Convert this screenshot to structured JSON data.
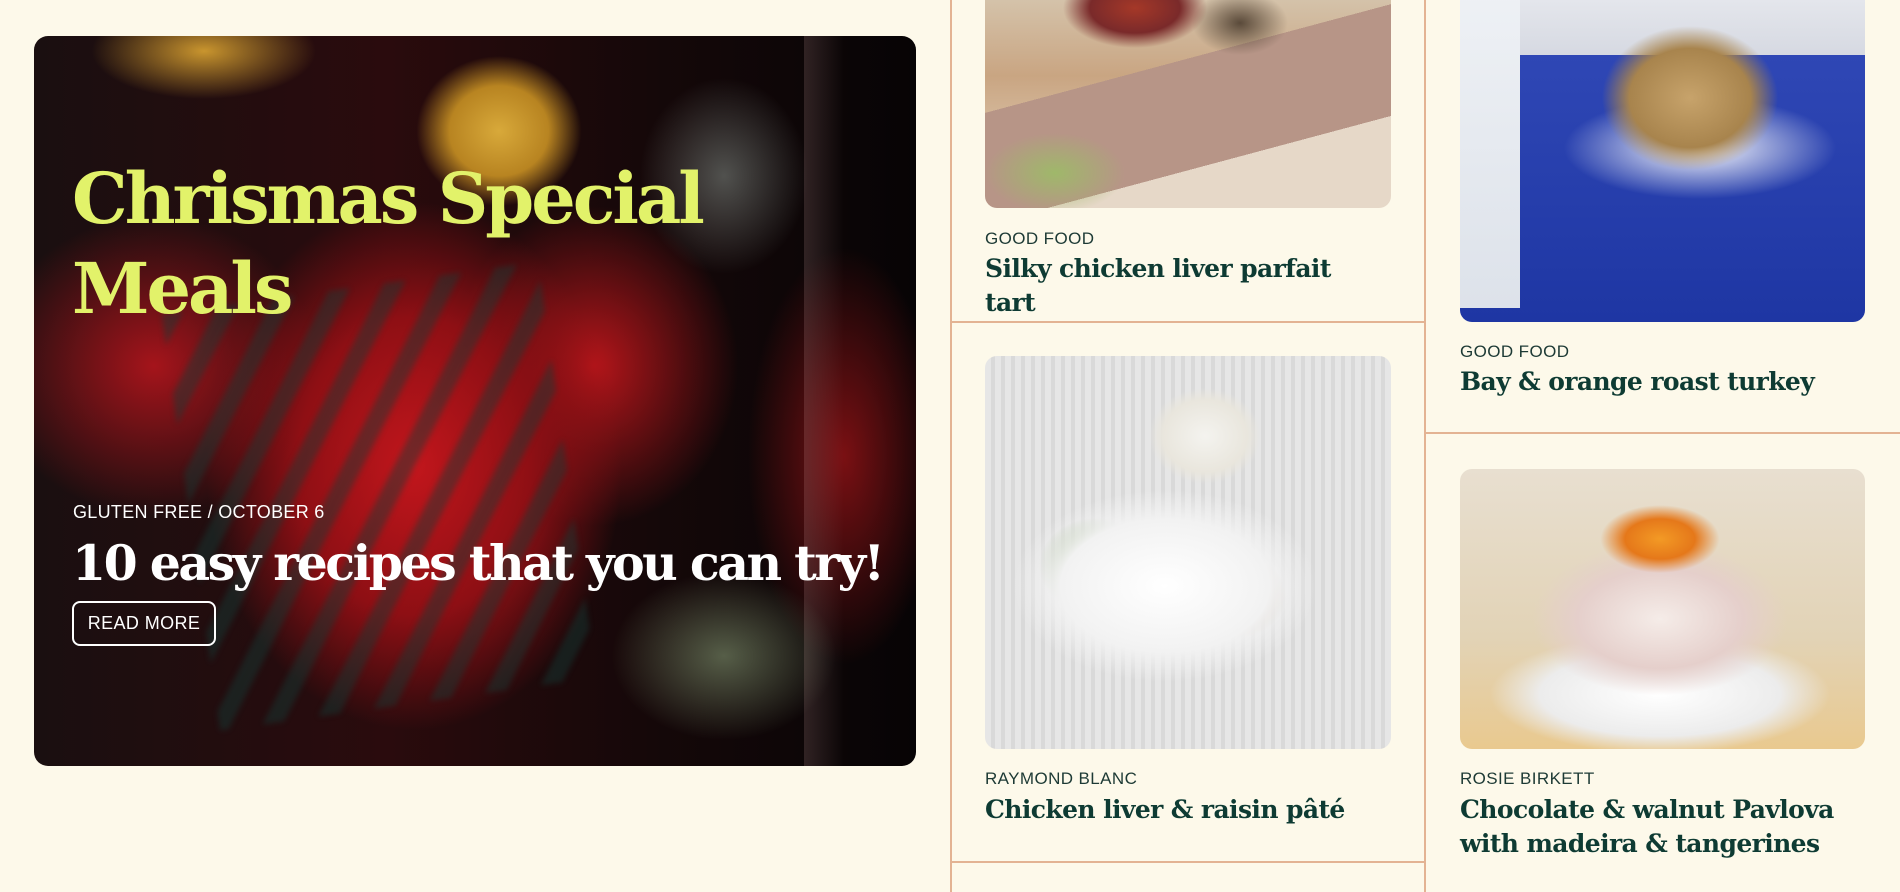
{
  "hero": {
    "title": "Chrismas Special Meals",
    "meta": "GLUTEN FREE / OCTOBER 6",
    "headline": "10 easy recipes that you can try!",
    "button_label": "READ MORE",
    "title_color": "#e2f26a"
  },
  "cards": [
    {
      "author": "GOOD FOOD",
      "title": "Silky chicken liver parfait tart"
    },
    {
      "author": "RAYMOND BLANC",
      "title": "Chicken liver & raisin pâté"
    },
    {
      "author": "GOOD FOOD",
      "title": "Bay & orange roast turkey"
    },
    {
      "author": "ROSIE BIRKETT",
      "title": "Chocolate & walnut Pavlova with madeira & tangerines"
    }
  ],
  "colors": {
    "background": "#fdf9ea",
    "divider": "#e3b393",
    "card_title": "#0e3b33"
  }
}
